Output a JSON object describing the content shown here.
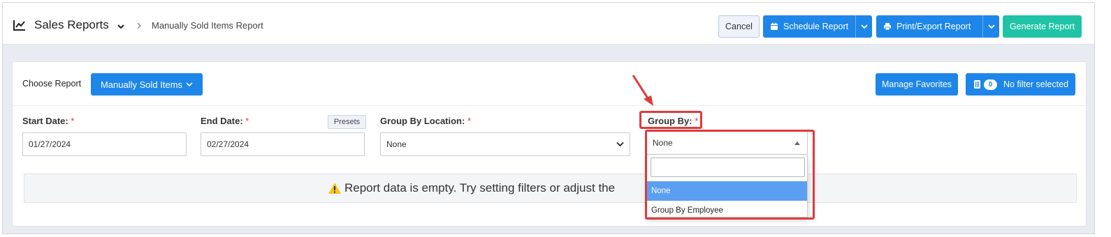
{
  "header": {
    "title": "Sales Reports",
    "breadcrumb": "Manually Sold Items Report",
    "cancel_label": "Cancel",
    "schedule_label": "Schedule Report",
    "print_label": "Print/Export Report",
    "generate_label": "Generate Report"
  },
  "report": {
    "choose_label": "Choose Report",
    "selected_report": "Manually Sold Items",
    "favorites_label": "Manage Favorites",
    "filter_count": "0",
    "filter_label": "No filter selected"
  },
  "filters": {
    "start_label": "Start Date:",
    "start_value": "01/27/2024",
    "end_label": "End Date:",
    "end_value": "02/27/2024",
    "presets_label": "Presets",
    "location_label": "Group By Location:",
    "location_value": "None",
    "groupby_label": "Group By:",
    "groupby_value": "None",
    "required_mark": "*"
  },
  "groupby_options": [
    "None",
    "Group By Employee"
  ],
  "empty_message": "Report data is empty. Try setting filters or adjust the",
  "colors": {
    "primary": "#1d86e8",
    "generate": "#20c3a6",
    "annotation": "#e03a3a",
    "option_highlight": "#5b9ff2"
  }
}
